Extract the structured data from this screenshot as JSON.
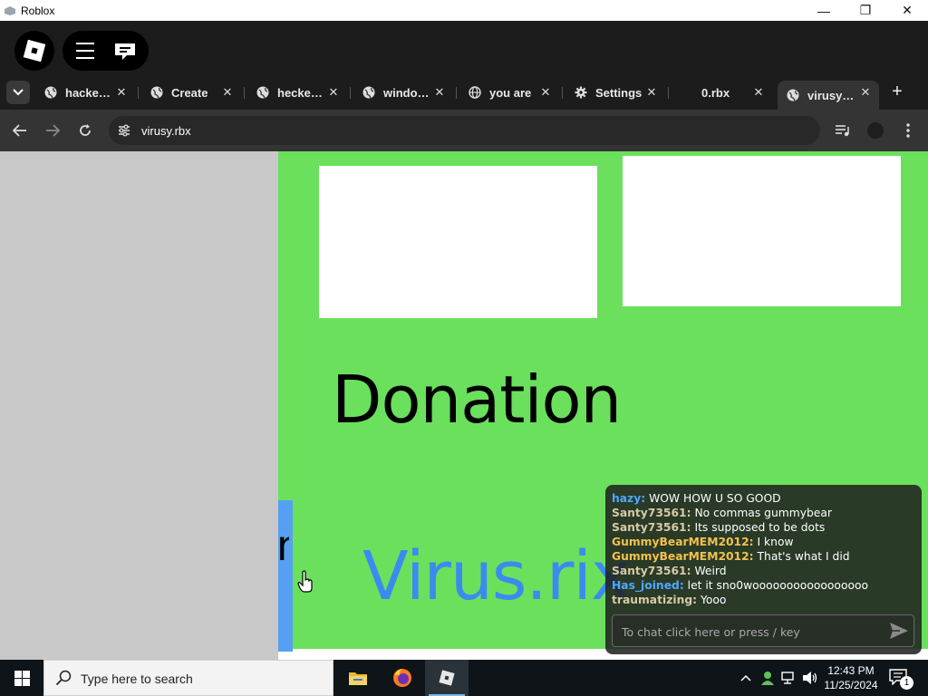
{
  "window": {
    "title": "Roblox",
    "controls": {
      "minimize": "—",
      "restore": "❐",
      "close": "✕"
    }
  },
  "tabs": [
    {
      "label": "hacke…",
      "icon": "globe-icon"
    },
    {
      "label": "Create",
      "icon": "globe-icon"
    },
    {
      "label": "hecke…",
      "icon": "globe-icon"
    },
    {
      "label": "windo…",
      "icon": "globe-icon"
    },
    {
      "label": "you are",
      "icon": "globe-outline-icon"
    },
    {
      "label": "Settings",
      "icon": "gear-icon"
    },
    {
      "label": "0.rbx",
      "icon": "none"
    },
    {
      "label": "virusy…",
      "icon": "globe-icon",
      "active": true
    }
  ],
  "tab_close": "✕",
  "new_tab": "+",
  "address": {
    "value": "virusy.rbx"
  },
  "page": {
    "heading": "Donation",
    "brand_text": "Virus.rix",
    "partial_glyph": "n"
  },
  "chat": {
    "messages": [
      {
        "user": "hazy:",
        "text": "WOW HOW U SO GOOD",
        "color": "#4fa8ff"
      },
      {
        "user": "Santy73561:",
        "text": "No commas gummybear",
        "color": "#d9c9a6"
      },
      {
        "user": "Santy73561:",
        "text": "Its supposed to be dots",
        "color": "#d9c9a6"
      },
      {
        "user": "GummyBearMEM2012:",
        "text": "I know",
        "color": "#f2c24b"
      },
      {
        "user": "GummyBearMEM2012:",
        "text": "That's what I did",
        "color": "#f2c24b"
      },
      {
        "user": "Santy73561:",
        "text": "Weird",
        "color": "#d9c9a6"
      },
      {
        "user": "Has_joined:",
        "text": "let it sno0wooooooooooooooooo",
        "color": "#4fa8ff"
      },
      {
        "user": "traumatizing:",
        "text": "Yooo",
        "color": "#d9c9a6"
      }
    ],
    "input_placeholder": "To chat click here or press / key"
  },
  "taskbar": {
    "search_placeholder": "Type here to search",
    "time": "12:43 PM",
    "date": "11/25/2024",
    "notifications": "1"
  },
  "colors": {
    "page_bg": "#6be05d",
    "left_panel": "#c8c8c8",
    "brand_text": "#3b8bef",
    "blue_bar": "#56a0f2"
  }
}
